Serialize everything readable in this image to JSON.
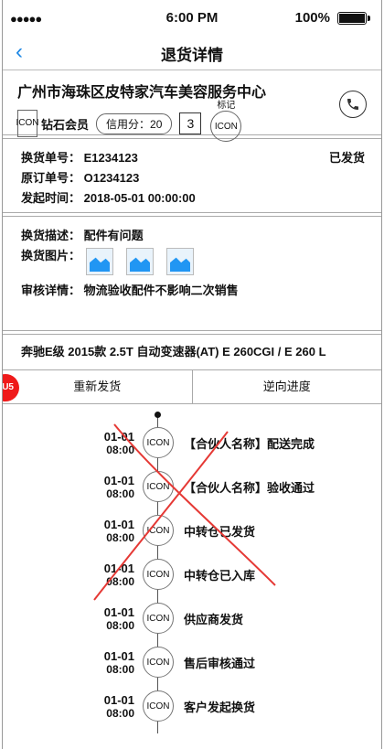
{
  "status_bar": {
    "signal": "●●●●● ",
    "time": "6:00 PM",
    "battery": "100%"
  },
  "nav": {
    "back_icon": "‹",
    "title": "退货详情"
  },
  "shop": {
    "name": "广州市海珠区皮特家汽车美容服务中心",
    "member_icon": "ICON",
    "member_level": "钻石会员",
    "credit": "信用分：20",
    "count": "3",
    "mark_label": "标记",
    "mark_icon": "ICON"
  },
  "order": {
    "exchange_no": "换货单号：  E1234123",
    "original_no": "原订单号：  O1234123",
    "start_time": "发起时间：  2018-05-01 00:00:00",
    "status": "已发货"
  },
  "description": {
    "desc": "换货描述：  配件有问题",
    "images_label": "换货图片：",
    "audit": "审核详情：  物流验收配件不影响二次销售"
  },
  "vehicle": "奔驰E级 2015款 2.5T 自动变速器(AT) E 260CGI / E 260 L",
  "actions": {
    "resend": "重新发货",
    "reverse_progress": "逆向进度",
    "badge": "U5"
  },
  "timeline": [
    {
      "date": "01-01",
      "time": "08:00",
      "icon": "ICON",
      "text": "【合伙人名称】配送完成"
    },
    {
      "date": "01-01",
      "time": "08:00",
      "icon": "ICON",
      "text": "【合伙人名称】验收通过"
    },
    {
      "date": "01-01",
      "time": "08:00",
      "icon": "ICON",
      "text": "中转仓已发货"
    },
    {
      "date": "01-01",
      "time": "08:00",
      "icon": "ICON",
      "text": "中转仓已入库"
    },
    {
      "date": "01-01",
      "time": "08:00",
      "icon": "ICON",
      "text": "供应商发货"
    },
    {
      "date": "01-01",
      "time": "08:00",
      "icon": "ICON",
      "text": "售后审核通过"
    },
    {
      "date": "01-01",
      "time": "08:00",
      "icon": "ICON",
      "text": "客户发起换货"
    }
  ],
  "colors": {
    "accent": "#1e88e5",
    "badge": "#ef1a1a",
    "annotation": "#e53935"
  }
}
